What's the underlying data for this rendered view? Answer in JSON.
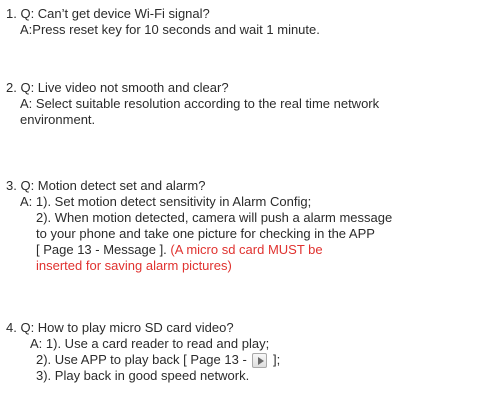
{
  "faq": {
    "item1": {
      "question": "1. Q: Can’t get device Wi-Fi signal?",
      "answer": "A:Press reset key for 10 seconds and wait 1 minute."
    },
    "item2": {
      "question": "2. Q: Live video not smooth and clear?",
      "answer_line1": "A: Select suitable resolution according to the real time network",
      "answer_line2": "environment."
    },
    "item3": {
      "question": "3. Q: Motion detect set and alarm?",
      "answer_line1": "A: 1). Set motion detect sensitivity in Alarm Config;",
      "answer_line2": "2). When motion detected, camera will push a alarm message",
      "answer_line3": "to your phone and take one picture for checking in the APP",
      "answer_line4": "[ Page 13 - Message ].",
      "warning_line1": "(A micro sd card MUST be",
      "warning_line2": "inserted for saving alarm pictures)",
      "warning_color": "#e0322f"
    },
    "item4": {
      "question": "4. Q: How to play micro SD card video?",
      "answer_line1": "A: 1). Use a card reader to read and play;",
      "answer_line2_before_icon": "2). Use APP to play back [ Page 13 -",
      "answer_line2_after_icon": "];",
      "answer_line2_icon": "play-icon",
      "answer_line3": "3). Play back in good speed network."
    }
  }
}
